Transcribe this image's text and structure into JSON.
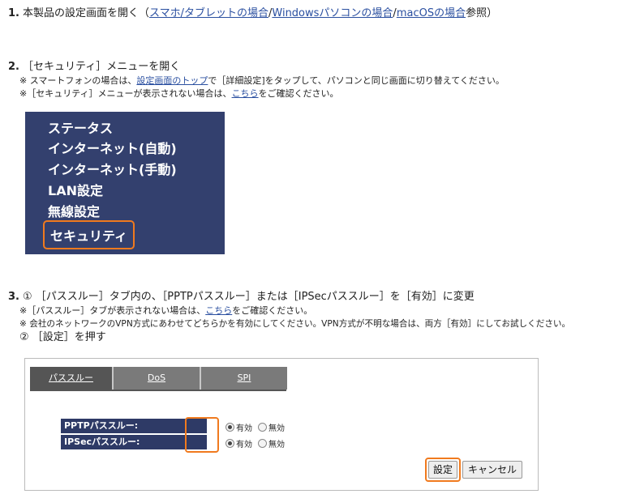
{
  "step1": {
    "number": "1.",
    "text_before": "本製品の設定画面を開く（",
    "link_smartphone": "スマホ/タブレットの場合",
    "sep1": "/",
    "link_windows": "Windowsパソコンの場合",
    "sep2": "/",
    "link_macos": "macOSの場合",
    "text_after": "参照）"
  },
  "step2": {
    "number": "2.",
    "title": "［セキュリティ］メニューを開く",
    "note1_before": "※ スマートフォンの場合は、",
    "note1_link": "設定画面のトップ",
    "note1_after": "で［詳細設定]をタップして、パソコンと同じ画面に切り替えてください。",
    "note2_before": "※［セキュリティ］メニューが表示されない場合は、",
    "note2_link": "こちら",
    "note2_after": "をご確認ください。",
    "menu": {
      "background": "#33406e",
      "highlight_color": "#f07a1e",
      "items": [
        "ステータス",
        "インターネット(自動)",
        "インターネット(手動)",
        "LAN設定",
        "無線設定",
        "セキュリティ"
      ]
    }
  },
  "step3": {
    "number": "3.",
    "title": "① ［パススルー］タブ内の、［PPTPパススルー］または［IPSecパススルー］を［有効］に変更",
    "note1_before": "※［パススルー］タブが表示されない場合は、",
    "note1_link": "こちら",
    "note1_after": "をご確認ください。",
    "note2": "※ 会社のネットワークのVPN方式にあわせてどちらかを有効にしてください。VPN方式が不明な場合は、両方［有効］にしてお試しください。",
    "sub2": "② ［設定］を押す",
    "panel": {
      "tabs": [
        "パススルー",
        "DoS",
        "SPI"
      ],
      "rows": [
        {
          "label": "PPTPパススルー:",
          "on": "有効",
          "off": "無効"
        },
        {
          "label": "IPSecパススルー:",
          "on": "有効",
          "off": "無効"
        }
      ],
      "apply_button": "設定",
      "cancel_button": "キャンセル"
    }
  }
}
